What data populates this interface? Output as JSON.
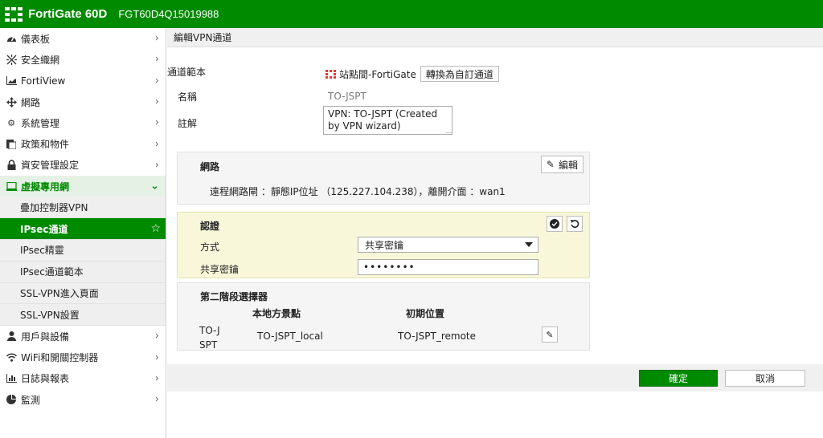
{
  "topbar": {
    "brand": "FortiGate 60D",
    "serial": "FGT60D4Q15019988",
    "color": "#008a00"
  },
  "sidebar": {
    "items": [
      {
        "label": "儀表板",
        "icon": "dashboard-icon"
      },
      {
        "label": "安全織網",
        "icon": "security-fabric-icon"
      },
      {
        "label": "FortiView",
        "icon": "fortiview-chart-icon"
      },
      {
        "label": "網路",
        "icon": "network-icon"
      },
      {
        "label": "系統管理",
        "icon": "gear-icon"
      },
      {
        "label": "政策和物件",
        "icon": "policy-icon"
      },
      {
        "label": "資安管理設定",
        "icon": "lock-icon"
      },
      {
        "label": "虛擬專用網",
        "icon": "vpn-monitor-icon"
      }
    ],
    "vpn_sub": [
      {
        "label": "疊加控制器VPN"
      },
      {
        "label": "IPsec通道"
      },
      {
        "label": "IPsec精靈"
      },
      {
        "label": "IPsec通道範本"
      },
      {
        "label": "SSL-VPN進入頁面"
      },
      {
        "label": "SSL-VPN設置"
      }
    ],
    "items_after": [
      {
        "label": "用戶與設備",
        "icon": "user-icon"
      },
      {
        "label": "WiFi和開關控制器",
        "icon": "wifi-icon"
      },
      {
        "label": "日誌與報表",
        "icon": "bar-chart-icon"
      },
      {
        "label": "監測",
        "icon": "pie-chart-icon"
      }
    ]
  },
  "page": {
    "title": "編輯VPN通道",
    "template_label": "通道範本",
    "template_value": "站點間-FortiGate",
    "convert_button": "轉換為自訂通道",
    "name_label": "名稱",
    "name_value": "TO-JSPT",
    "comment_label": "註解",
    "comment_value": "VPN: TO-JSPT (Created by VPN wizard)"
  },
  "network": {
    "title": "網路",
    "edit_button": "編輯",
    "info": "遠程網路閘 ：靜態IP位址 （125.227.104.238），離開介面 ：wan1"
  },
  "auth": {
    "title": "認證",
    "method_label": "方式",
    "method_value": "共享密鑰",
    "psk_label": "共享密鑰",
    "psk_value": "••••••••",
    "bg_color": "#f9f7d9"
  },
  "phase2": {
    "title": "第二階段選擇器",
    "col_local": "本地方景點",
    "col_remote": "初期位置",
    "row_name": "TO-JSPT",
    "row_local": "TO-JSPT_local",
    "row_remote": "TO-JSPT_remote"
  },
  "footer": {
    "ok": "確定",
    "cancel": "取消"
  }
}
